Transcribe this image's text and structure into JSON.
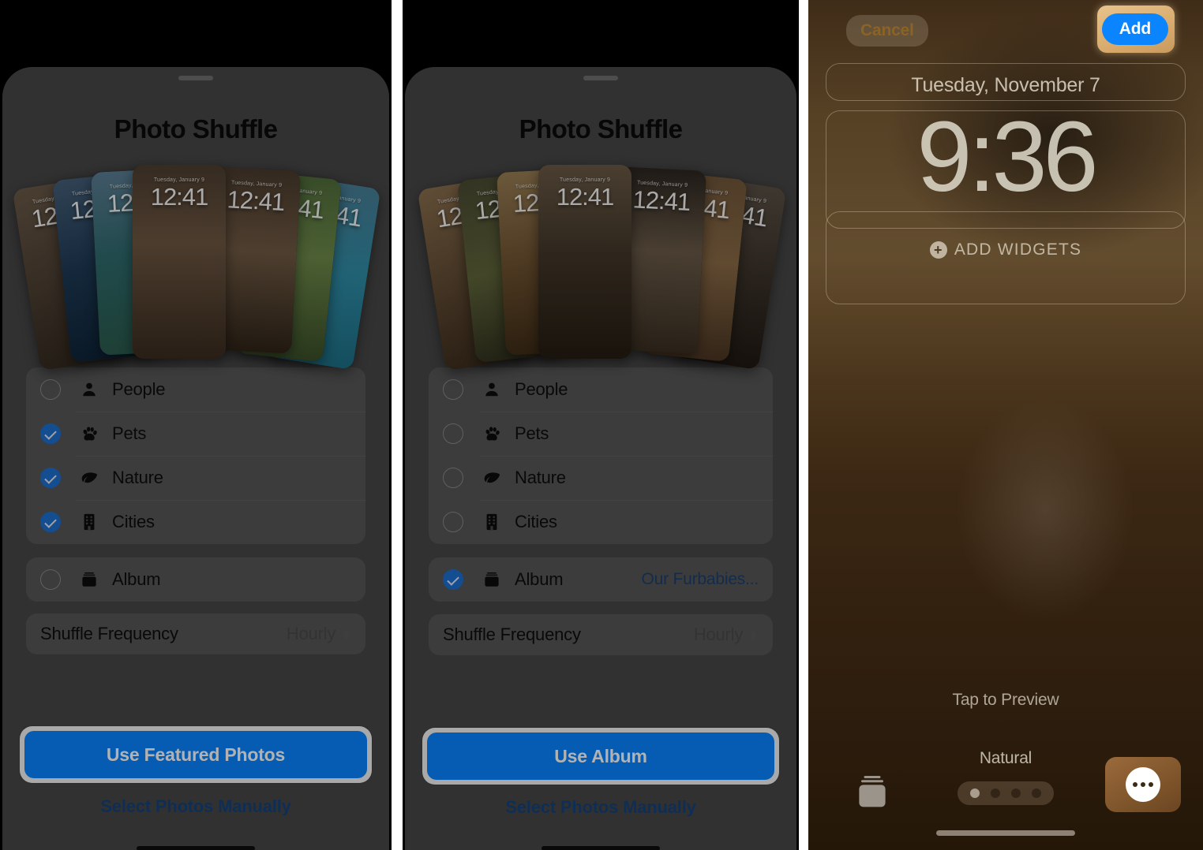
{
  "panels": [
    {
      "id": "photo-shuffle-featured",
      "title": "Photo Shuffle",
      "stack": {
        "card_date": "Tuesday, January 9",
        "card_time": "12:41"
      },
      "options": [
        {
          "label": "People",
          "icon": "person-icon",
          "checked": false
        },
        {
          "label": "Pets",
          "icon": "paw-icon",
          "checked": true
        },
        {
          "label": "Nature",
          "icon": "leaf-icon",
          "checked": true
        },
        {
          "label": "Cities",
          "icon": "building-icon",
          "checked": true
        }
      ],
      "album": {
        "label": "Album",
        "icon": "album-icon",
        "checked": false,
        "value": ""
      },
      "frequency": {
        "label": "Shuffle Frequency",
        "value": "Hourly"
      },
      "primary_button": "Use Featured Photos",
      "secondary_button": "Select Photos Manually"
    },
    {
      "id": "photo-shuffle-album",
      "title": "Photo Shuffle",
      "stack": {
        "card_date": "Tuesday, January 9",
        "card_time": "12:41"
      },
      "options": [
        {
          "label": "People",
          "icon": "person-icon",
          "checked": false
        },
        {
          "label": "Pets",
          "icon": "paw-icon",
          "checked": false
        },
        {
          "label": "Nature",
          "icon": "leaf-icon",
          "checked": false
        },
        {
          "label": "Cities",
          "icon": "building-icon",
          "checked": false
        }
      ],
      "album": {
        "label": "Album",
        "icon": "album-icon",
        "checked": true,
        "value": "Our Furbabies..."
      },
      "frequency": {
        "label": "Shuffle Frequency",
        "value": "Hourly"
      },
      "primary_button": "Use Album",
      "secondary_button": "Select Photos Manually"
    }
  ],
  "lockscreen": {
    "cancel_label": "Cancel",
    "add_label": "Add",
    "date": "Tuesday, November 7",
    "time": "9:36",
    "add_widgets_label": "ADD WIDGETS",
    "tap_to_preview": "Tap to Preview",
    "style_name": "Natural",
    "style_dots": 4,
    "style_active_index": 0
  },
  "colors": {
    "accent_blue": "#0a84ff",
    "checked_blue": "#1f6fd0",
    "link_blue": "#1d3f6e",
    "sheet_bg": "#474747",
    "highlight_ring": "#f2f2f2",
    "add_highlight": "#d8ab6d"
  }
}
